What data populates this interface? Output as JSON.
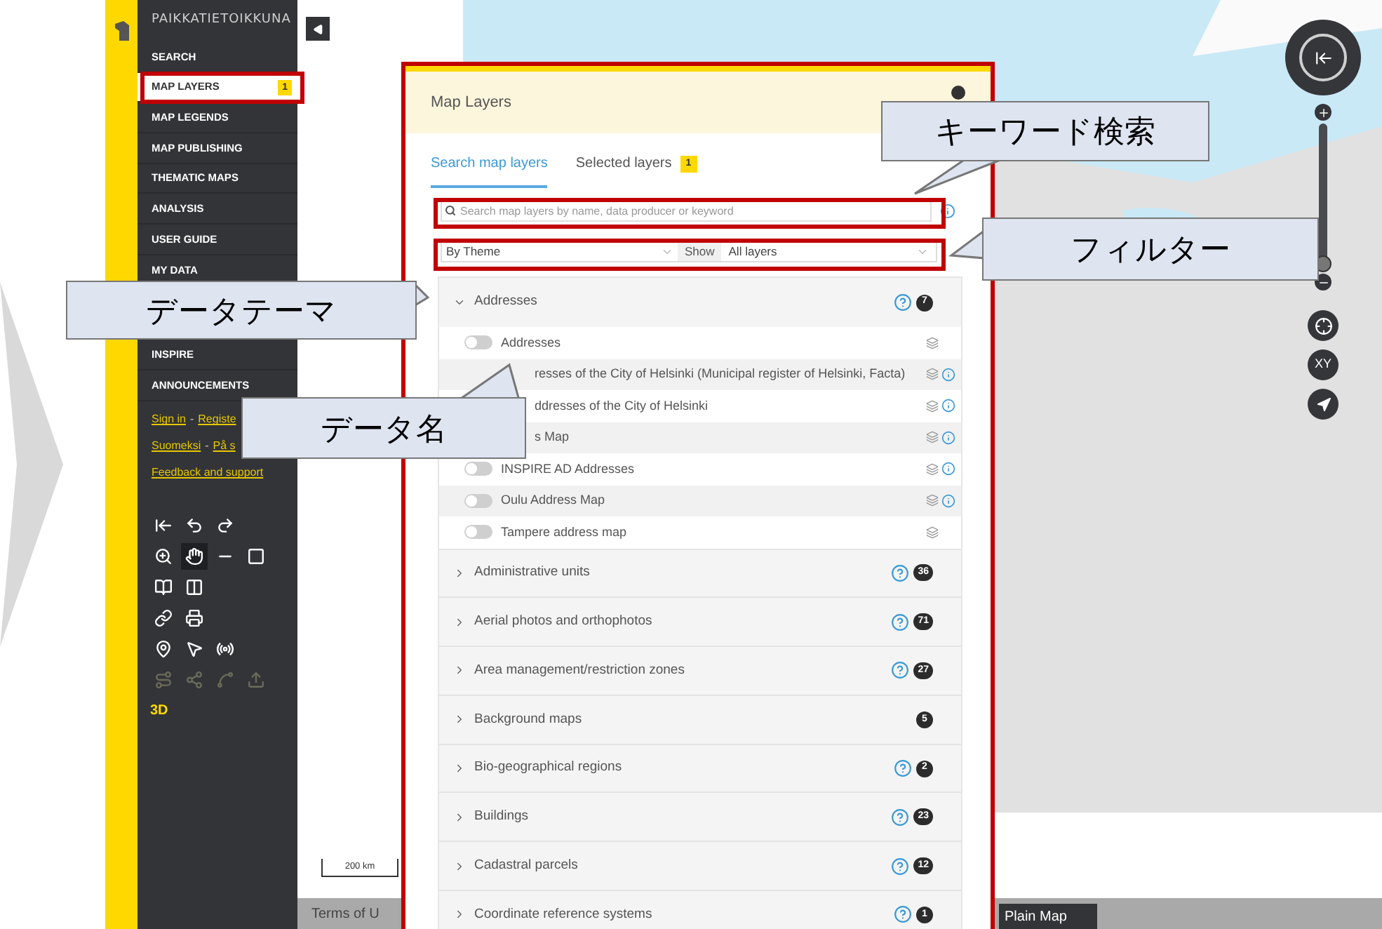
{
  "sidebar": {
    "title": "PAIKKATIETOIKKUNA",
    "items": [
      {
        "label": "SEARCH",
        "selected": false
      },
      {
        "label": "MAP LAYERS",
        "selected": true,
        "badge": "1"
      },
      {
        "label": "MAP LEGENDS",
        "selected": false
      },
      {
        "label": "MAP PUBLISHING",
        "selected": false
      },
      {
        "label": "THEMATIC MAPS",
        "selected": false
      },
      {
        "label": "ANALYSIS",
        "selected": false
      },
      {
        "label": "USER GUIDE",
        "selected": false
      },
      {
        "label": "MY DATA",
        "selected": false
      },
      {
        "kind": "gap"
      },
      {
        "label": "INSPIRE",
        "selected": false
      },
      {
        "label": "ANNOUNCEMENTS",
        "selected": false
      }
    ],
    "links": [
      [
        {
          "kind": "link",
          "text": "Sign in"
        },
        {
          "kind": "separator",
          "text": "-"
        },
        {
          "kind": "link",
          "text": "Registe"
        }
      ],
      [
        {
          "kind": "link",
          "text": "Suomeksi"
        },
        {
          "kind": "separator",
          "text": "-"
        },
        {
          "kind": "link",
          "text": "På s"
        }
      ],
      [
        {
          "kind": "link",
          "text": "Feedback and support"
        }
      ]
    ],
    "tools": [
      [
        {
          "kind": "reset",
          "selected": false,
          "disabled": false
        },
        {
          "kind": "undo",
          "selected": false,
          "disabled": false
        },
        {
          "kind": "redo",
          "selected": false,
          "disabled": false
        }
      ],
      [
        {
          "kind": "zoom-box",
          "selected": false,
          "disabled": false
        },
        {
          "kind": "pan",
          "selected": true,
          "disabled": false
        },
        {
          "kind": "measure-line",
          "selected": false,
          "disabled": false
        },
        {
          "kind": "measure-area",
          "selected": false,
          "disabled": false
        }
      ],
      [
        {
          "kind": "book",
          "selected": false,
          "disabled": false
        },
        {
          "kind": "split",
          "selected": false,
          "disabled": false
        }
      ],
      [
        {
          "kind": "link",
          "selected": false,
          "disabled": false
        },
        {
          "kind": "print",
          "selected": false,
          "disabled": false
        }
      ],
      [
        {
          "kind": "pin",
          "selected": false,
          "disabled": false
        },
        {
          "kind": "select",
          "selected": false,
          "disabled": false
        },
        {
          "kind": "broadcast",
          "selected": false,
          "disabled": false
        }
      ],
      [
        {
          "kind": "route",
          "selected": false,
          "disabled": true
        },
        {
          "kind": "share",
          "selected": false,
          "disabled": true
        },
        {
          "kind": "spline",
          "selected": false,
          "disabled": true
        },
        {
          "kind": "upload",
          "selected": false,
          "disabled": true
        }
      ]
    ],
    "mode_3d": "3D"
  },
  "map": {
    "scale": "200 km",
    "terms": "Terms of U",
    "basemap": "Plain Map",
    "zoom": {
      "level": 0.05
    },
    "coords_button": "XY"
  },
  "panel": {
    "title": "Map Layers",
    "tabs": [
      {
        "label": "Search map layers",
        "selected": true
      },
      {
        "label": "Selected layers",
        "selected": false,
        "badge": "1"
      }
    ],
    "search": {
      "placeholder": "Search map layers by name, data producer or keyword"
    },
    "grouping": "By Theme",
    "show_label": "Show",
    "show_value": "All layers",
    "groups": [
      {
        "name": "Addresses",
        "expanded": true,
        "help": true,
        "count": "7",
        "layers": [
          {
            "kind": "toggle",
            "name": "Addresses",
            "on": false,
            "info": false
          },
          {
            "kind": "covered",
            "name": "resses of the City of Helsinki (Municipal register of Helsinki, Facta)",
            "info": true
          },
          {
            "kind": "covered",
            "name": "ddresses of the City of Helsinki",
            "info": true
          },
          {
            "kind": "covered",
            "name": "s Map",
            "info": true
          },
          {
            "kind": "toggle",
            "name": "INSPIRE AD Addresses",
            "on": false,
            "info": true
          },
          {
            "kind": "toggle",
            "name": "Oulu Address Map",
            "on": false,
            "info": true
          },
          {
            "kind": "toggle",
            "name": "Tampere address map",
            "on": false,
            "info": false
          }
        ]
      },
      {
        "name": "Administrative units",
        "expanded": false,
        "help": true,
        "count": "36"
      },
      {
        "name": "Aerial photos and orthophotos",
        "expanded": false,
        "help": true,
        "count": "71"
      },
      {
        "name": "Area management/restriction zones",
        "expanded": false,
        "help": true,
        "count": "27"
      },
      {
        "name": "Background maps",
        "expanded": false,
        "help": false,
        "count": "5"
      },
      {
        "name": "Bio-geographical regions",
        "expanded": false,
        "help": true,
        "count": "2"
      },
      {
        "name": "Buildings",
        "expanded": false,
        "help": true,
        "count": "23"
      },
      {
        "name": "Cadastral parcels",
        "expanded": false,
        "help": true,
        "count": "12"
      },
      {
        "name": "Coordinate reference systems",
        "expanded": false,
        "help": true,
        "count": "1"
      }
    ]
  },
  "callouts": [
    {
      "text": "キーワード検索"
    },
    {
      "text": "フィルター"
    },
    {
      "text": "データテーマ"
    },
    {
      "text": "データ名"
    }
  ]
}
